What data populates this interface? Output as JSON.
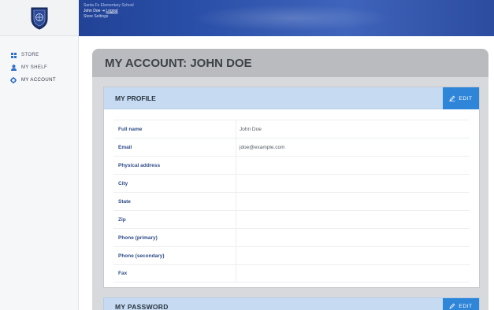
{
  "header": {
    "school_name": "Santa Fe Elementary School",
    "user_name": "John Doe",
    "logout_label": "Logout",
    "store_settings_label": "Store Settings",
    "colors": {
      "bar_start": "#1c3a8a",
      "bar_end": "#3f64bb"
    }
  },
  "sidebar": {
    "items": [
      {
        "label": "STORE",
        "icon": "grid-icon"
      },
      {
        "label": "MY SHELF",
        "icon": "user-icon"
      },
      {
        "label": "MY ACCOUNT",
        "icon": "gear-icon"
      }
    ]
  },
  "main": {
    "title": "MY ACCOUNT: JOHN DOE",
    "profile": {
      "title": "MY PROFILE",
      "edit_label": "EDIT",
      "fields": [
        {
          "label": "Full name",
          "value": "John Doe"
        },
        {
          "label": "Email",
          "value": "jdoe@example.com"
        },
        {
          "label": "Physical address",
          "value": ""
        },
        {
          "label": "City",
          "value": ""
        },
        {
          "label": "State",
          "value": ""
        },
        {
          "label": "Zip",
          "value": ""
        },
        {
          "label": "Phone (primary)",
          "value": ""
        },
        {
          "label": "Phone (secondary)",
          "value": ""
        },
        {
          "label": "Fax",
          "value": ""
        }
      ]
    },
    "password": {
      "title": "MY PASSWORD",
      "edit_label": "EDIT"
    },
    "colors": {
      "accent": "#2f86d8",
      "panel_header": "#c6dbf2",
      "label_text": "#2d4b86"
    }
  }
}
